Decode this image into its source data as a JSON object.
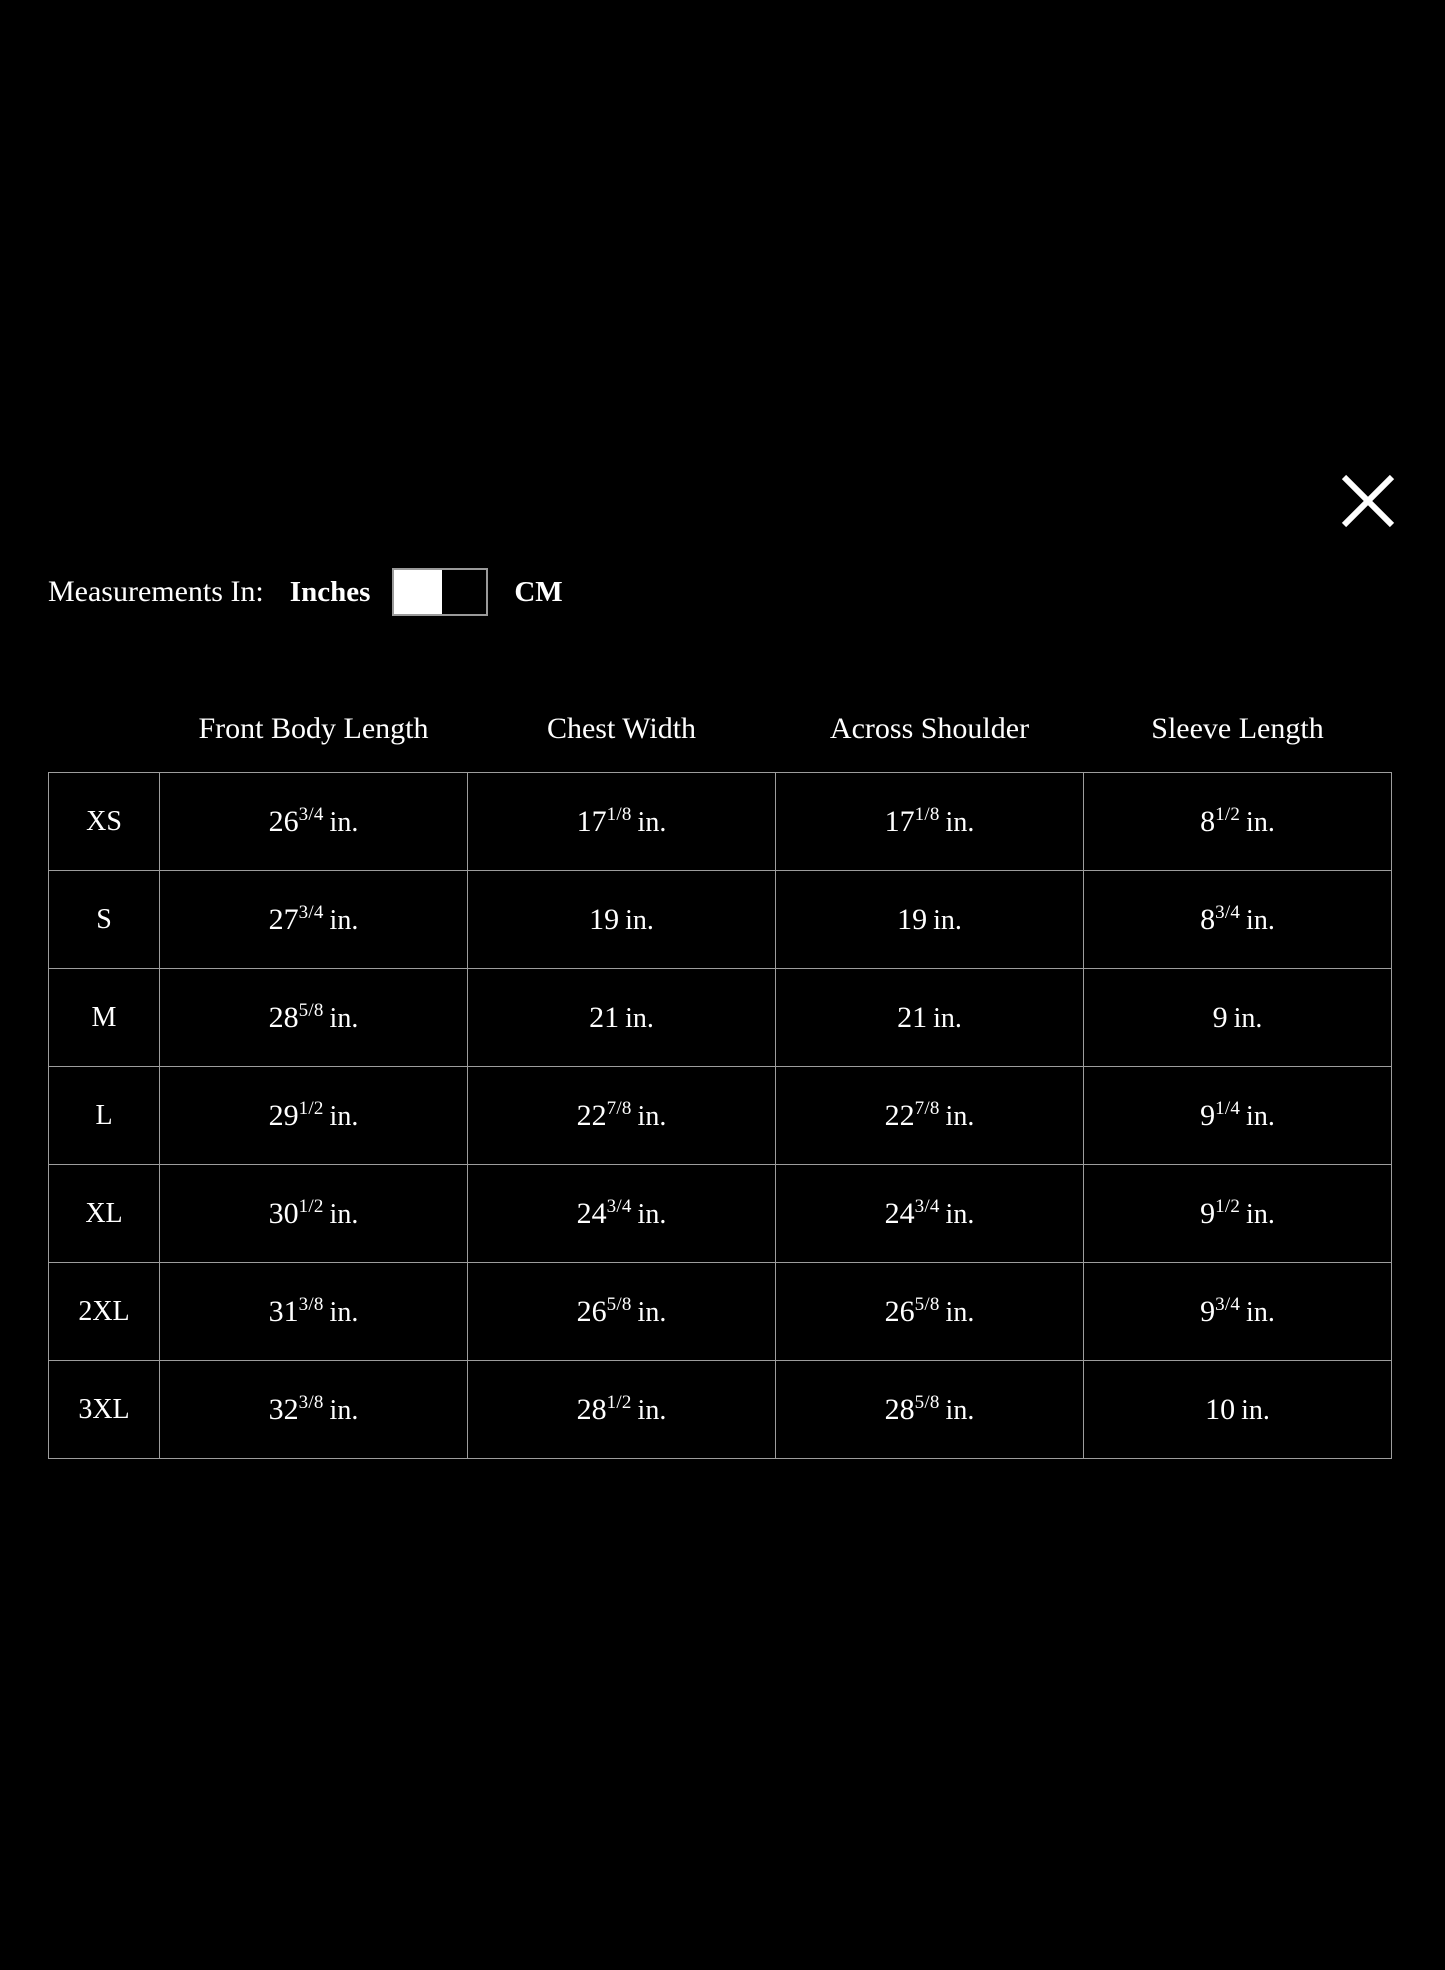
{
  "modal": {
    "background_color": "#000000",
    "text_color": "#ffffff",
    "border_color": "#9d9d9d",
    "close_icon_name": "close-icon"
  },
  "units": {
    "prompt_label": "Measurements In:",
    "option_inches": "Inches",
    "option_cm": "CM",
    "selected": "Inches",
    "toggle_state": "left"
  },
  "table": {
    "size_column_header": "",
    "headers": [
      "Front Body Length",
      "Chest Width",
      "Across Shoulder",
      "Sleeve Length"
    ],
    "unit_suffix": "in.",
    "rows": [
      {
        "size": "XS",
        "values": [
          {
            "whole": "26",
            "fraction": "3/4",
            "unit": "in."
          },
          {
            "whole": "17",
            "fraction": "1/8",
            "unit": "in."
          },
          {
            "whole": "17",
            "fraction": "1/8",
            "unit": "in."
          },
          {
            "whole": "8",
            "fraction": "1/2",
            "unit": "in."
          }
        ]
      },
      {
        "size": "S",
        "values": [
          {
            "whole": "27",
            "fraction": "3/4",
            "unit": "in."
          },
          {
            "whole": "19",
            "fraction": "",
            "unit": "in."
          },
          {
            "whole": "19",
            "fraction": "",
            "unit": "in."
          },
          {
            "whole": "8",
            "fraction": "3/4",
            "unit": "in."
          }
        ]
      },
      {
        "size": "M",
        "values": [
          {
            "whole": "28",
            "fraction": "5/8",
            "unit": "in."
          },
          {
            "whole": "21",
            "fraction": "",
            "unit": "in."
          },
          {
            "whole": "21",
            "fraction": "",
            "unit": "in."
          },
          {
            "whole": "9",
            "fraction": "",
            "unit": "in."
          }
        ]
      },
      {
        "size": "L",
        "values": [
          {
            "whole": "29",
            "fraction": "1/2",
            "unit": "in."
          },
          {
            "whole": "22",
            "fraction": "7/8",
            "unit": "in."
          },
          {
            "whole": "22",
            "fraction": "7/8",
            "unit": "in."
          },
          {
            "whole": "9",
            "fraction": "1/4",
            "unit": "in."
          }
        ]
      },
      {
        "size": "XL",
        "values": [
          {
            "whole": "30",
            "fraction": "1/2",
            "unit": "in."
          },
          {
            "whole": "24",
            "fraction": "3/4",
            "unit": "in."
          },
          {
            "whole": "24",
            "fraction": "3/4",
            "unit": "in."
          },
          {
            "whole": "9",
            "fraction": "1/2",
            "unit": "in."
          }
        ]
      },
      {
        "size": "2XL",
        "values": [
          {
            "whole": "31",
            "fraction": "3/8",
            "unit": "in."
          },
          {
            "whole": "26",
            "fraction": "5/8",
            "unit": "in."
          },
          {
            "whole": "26",
            "fraction": "5/8",
            "unit": "in."
          },
          {
            "whole": "9",
            "fraction": "3/4",
            "unit": "in."
          }
        ]
      },
      {
        "size": "3XL",
        "values": [
          {
            "whole": "32",
            "fraction": "3/8",
            "unit": "in."
          },
          {
            "whole": "28",
            "fraction": "1/2",
            "unit": "in."
          },
          {
            "whole": "28",
            "fraction": "5/8",
            "unit": "in."
          },
          {
            "whole": "10",
            "fraction": "",
            "unit": "in."
          }
        ]
      }
    ]
  }
}
